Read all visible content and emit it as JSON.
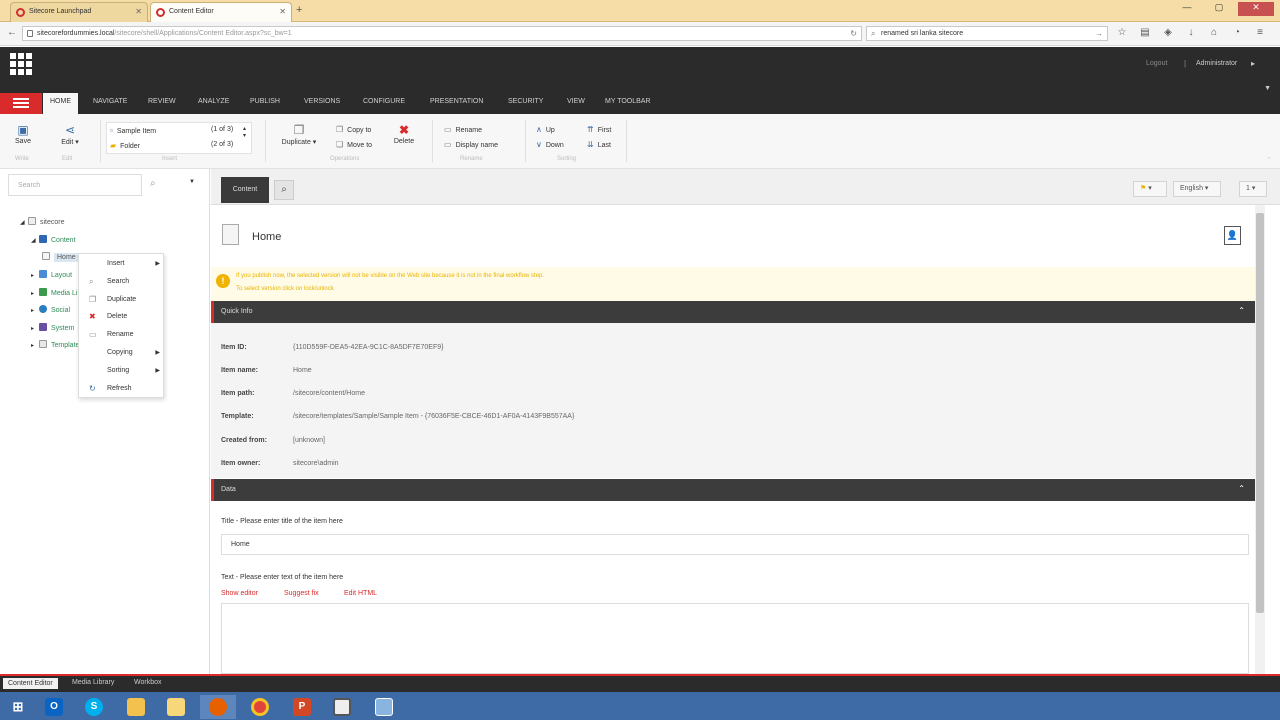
{
  "browser": {
    "tabs": [
      {
        "label": "Sitecore Launchpad",
        "active": false
      },
      {
        "label": "Content Editor",
        "active": true
      }
    ],
    "url_host": "sitecorefordummies.local",
    "url_path": "/sitecore/shell/Applications/Content Editor.aspx?sc_bw=1",
    "search_text": "renamed sri lanka sitecore"
  },
  "sitecore_bar": {
    "logout": "Logout",
    "separator": "|",
    "user": "Administrator"
  },
  "ribbon_tabs": [
    "HOME",
    "NAVIGATE",
    "REVIEW",
    "ANALYZE",
    "PUBLISH",
    "VERSIONS",
    "CONFIGURE",
    "PRESENTATION",
    "SECURITY",
    "VIEW",
    "MY TOOLBAR"
  ],
  "ribbon": {
    "save": "Save",
    "edit": "Edit",
    "insert_item1": "Sample Item",
    "insert_item1_count": "(1 of 3)",
    "insert_item2": "Folder",
    "insert_item2_count": "(2 of 3)",
    "duplicate": "Duplicate",
    "copy_to": "Copy to",
    "move_to": "Move to",
    "delete": "Delete",
    "rename": "Rename",
    "display_name": "Display name",
    "up": "Up",
    "down": "Down",
    "first": "First",
    "last": "Last",
    "group_labels": [
      "Write",
      "Edit",
      "Insert",
      "Operations",
      "Rename",
      "Sorting"
    ]
  },
  "left": {
    "search_placeholder": "Search",
    "tree": {
      "root": "sitecore",
      "content": "Content",
      "home": "Home",
      "children": [
        "Layout",
        "Media Library",
        "Social",
        "System",
        "Templates"
      ]
    },
    "context_menu": [
      "Insert",
      "Search",
      "Duplicate",
      "Delete",
      "Rename",
      "Copying",
      "Sorting",
      "Refresh"
    ]
  },
  "contentbar": {
    "tab": "Content",
    "language": "English",
    "version": "1"
  },
  "editor": {
    "item_title": "Home",
    "warning_line1": "If you publish now, the selected version will not be visible on the Web site because it is not in the final workflow step.",
    "warning_line2": "To select version click on lock/unlock",
    "quick_info_header": "Quick Info",
    "quick_info": [
      {
        "key": "Item ID:",
        "value": "{110D559F-DEA5-42EA-9C1C-8A5DF7E70EF9}"
      },
      {
        "key": "Item name:",
        "value": "Home"
      },
      {
        "key": "Item path:",
        "value": "/sitecore/content/Home"
      },
      {
        "key": "Template:",
        "value": "/sitecore/templates/Sample/Sample Item - {76036F5E-CBCE-46D1-AF0A-4143F9B557AA}"
      },
      {
        "key": "Created from:",
        "value": "[unknown]"
      },
      {
        "key": "Item owner:",
        "value": "sitecore\\admin"
      }
    ],
    "data_header": "Data",
    "title_label": "Title - Please enter title of the item here",
    "title_value": "Home",
    "text_label": "Text - Please enter text of the item here",
    "links": [
      "Show editor",
      "Suggest fix",
      "Edit HTML"
    ]
  },
  "bottom_tabs": [
    "Content Editor",
    "Media Library",
    "Workbox"
  ]
}
